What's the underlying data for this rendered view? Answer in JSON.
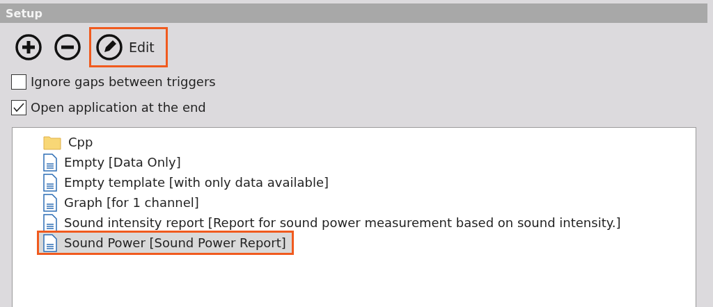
{
  "panel": {
    "title": "Setup"
  },
  "toolbar": [
    {
      "kind": "add",
      "highlighted": false
    },
    {
      "kind": "remove",
      "highlighted": false
    },
    {
      "kind": "edit",
      "label": "Edit",
      "highlighted": true
    }
  ],
  "options": [
    {
      "label": "Ignore gaps between triggers",
      "checked": false
    },
    {
      "label": "Open application at the end",
      "checked": true
    }
  ],
  "templates": [
    {
      "kind": "folder",
      "label": "Cpp",
      "selected": false,
      "highlighted": false
    },
    {
      "kind": "document",
      "label": "Empty [Data Only]",
      "selected": false,
      "highlighted": false
    },
    {
      "kind": "document",
      "label": "Empty template [with only data available]",
      "selected": false,
      "highlighted": false
    },
    {
      "kind": "document",
      "label": "Graph [for 1 channel]",
      "selected": false,
      "highlighted": false
    },
    {
      "kind": "document",
      "label": "Sound intensity report [Report for sound power measurement based on sound intensity.]",
      "selected": false,
      "highlighted": false
    },
    {
      "kind": "document",
      "label": "Sound Power [Sound Power Report]",
      "selected": true,
      "highlighted": true
    }
  ]
}
